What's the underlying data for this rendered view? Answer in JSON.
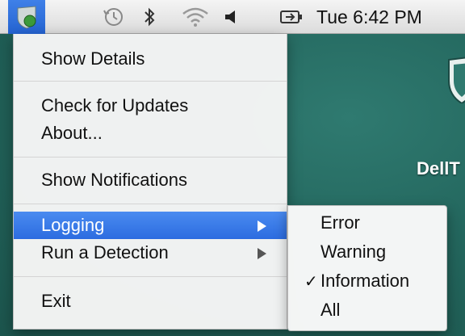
{
  "menubar": {
    "app_icon": "dell-threat-defense-shield-icon",
    "status_icons": [
      "time-machine-icon",
      "bluetooth-icon",
      "wifi-icon",
      "volume-icon",
      "input-source-icon"
    ],
    "clock": "Tue 6:42 PM"
  },
  "desktop": {
    "label": "DellT"
  },
  "main_menu": {
    "items": [
      {
        "label": "Show Details"
      },
      {
        "label": "Check for Updates"
      },
      {
        "label": "About..."
      },
      {
        "label": "Show Notifications"
      },
      {
        "label": "Logging",
        "has_submenu": true,
        "highlighted": true
      },
      {
        "label": "Run a Detection",
        "has_submenu": true
      },
      {
        "label": "Exit"
      }
    ]
  },
  "submenu": {
    "items": [
      {
        "label": "Error",
        "checked": false
      },
      {
        "label": "Warning",
        "checked": false
      },
      {
        "label": "Information",
        "checked": true
      },
      {
        "label": "All",
        "checked": false
      }
    ],
    "check_mark": "✓"
  },
  "colors": {
    "highlight": "#2c6ce0",
    "desktop": "#23665d"
  }
}
